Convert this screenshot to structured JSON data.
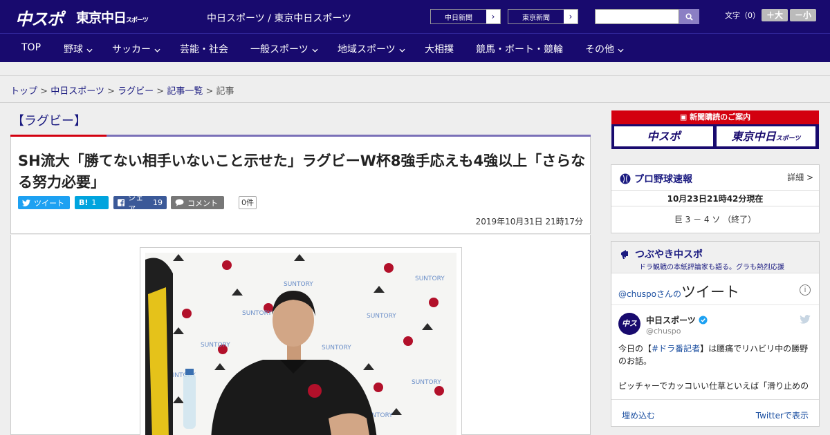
{
  "header": {
    "logo_chuspo": "中スポ",
    "logo_tokyo": "東京中日",
    "logo_tokyo_small": "スポーツ",
    "sites_text": "中日スポーツ / 東京中日スポーツ",
    "link_chunichi": "中日新聞",
    "link_tokyo": "東京新聞",
    "search_placeholder": "",
    "font_label": "文字（0）",
    "font_larger": "＋大",
    "font_smaller": "－小"
  },
  "nav": {
    "items": [
      "TOP",
      "野球",
      "サッカー",
      "芸能・社会",
      "一般スポーツ",
      "地域スポーツ",
      "大相撲",
      "競馬・ボート・競輪",
      "その他"
    ]
  },
  "breadcrumb": {
    "items": [
      "トップ",
      "中日スポーツ",
      "ラグビー",
      "記事一覧"
    ],
    "sep": ">",
    "current": "記事"
  },
  "article": {
    "category": "【ラグビー】",
    "headline": "SH流大「勝てない相手いないこと示せた」ラグビーW杯8強手応えも4強以上「さらなる努力必要」",
    "tweet_label": "ツイート",
    "hatena_label": "B!",
    "hatena_count": "1",
    "share_label": "シェア",
    "share_count": "19",
    "comment_label": "コメント",
    "comment_count": "0件",
    "date": "2019年10月31日 21時17分"
  },
  "sidebar": {
    "promo_title": "新聞購読のご案内",
    "promo_chuspo": "中スポ",
    "promo_tokyo": "東京中日",
    "promo_tokyo_small": "スポーツ",
    "baseball_title": "プロ野球速報",
    "baseball_detail": "詳細 >",
    "baseball_time": "10月23日21時42分現在",
    "baseball_score": "巨 3 － 4 ソ （終了）",
    "tweets_title": "つぶやき中スポ",
    "tweets_sub": "ドラ観戦の本紙評論家も語る。グラも熱烈応援",
    "tweets_handle_prefix": "@chuspo",
    "tweets_handle_suffix": "さんの",
    "tweets_big": "ツイート",
    "tweet_avatar": "中スポ",
    "tweet_name": "中日スポーツ",
    "tweet_handle": "@chuspo",
    "tweet_text_1": "今日の【",
    "tweet_hashtag": "#ドラ番記者",
    "tweet_text_2": "】は腰痛でリハビリ中の勝野のお話。",
    "tweet_text_3": "ピッチャーでカッコいい仕草といえば「滑り止めの",
    "embed_label": "埋め込む",
    "view_label": "Twitterで表示"
  },
  "colors": {
    "brand": "#180a6e",
    "accent_red": "#d3000f",
    "twitter": "#1da1f2",
    "hatena": "#00a4de",
    "facebook": "#3b5998",
    "comment": "#777777"
  }
}
